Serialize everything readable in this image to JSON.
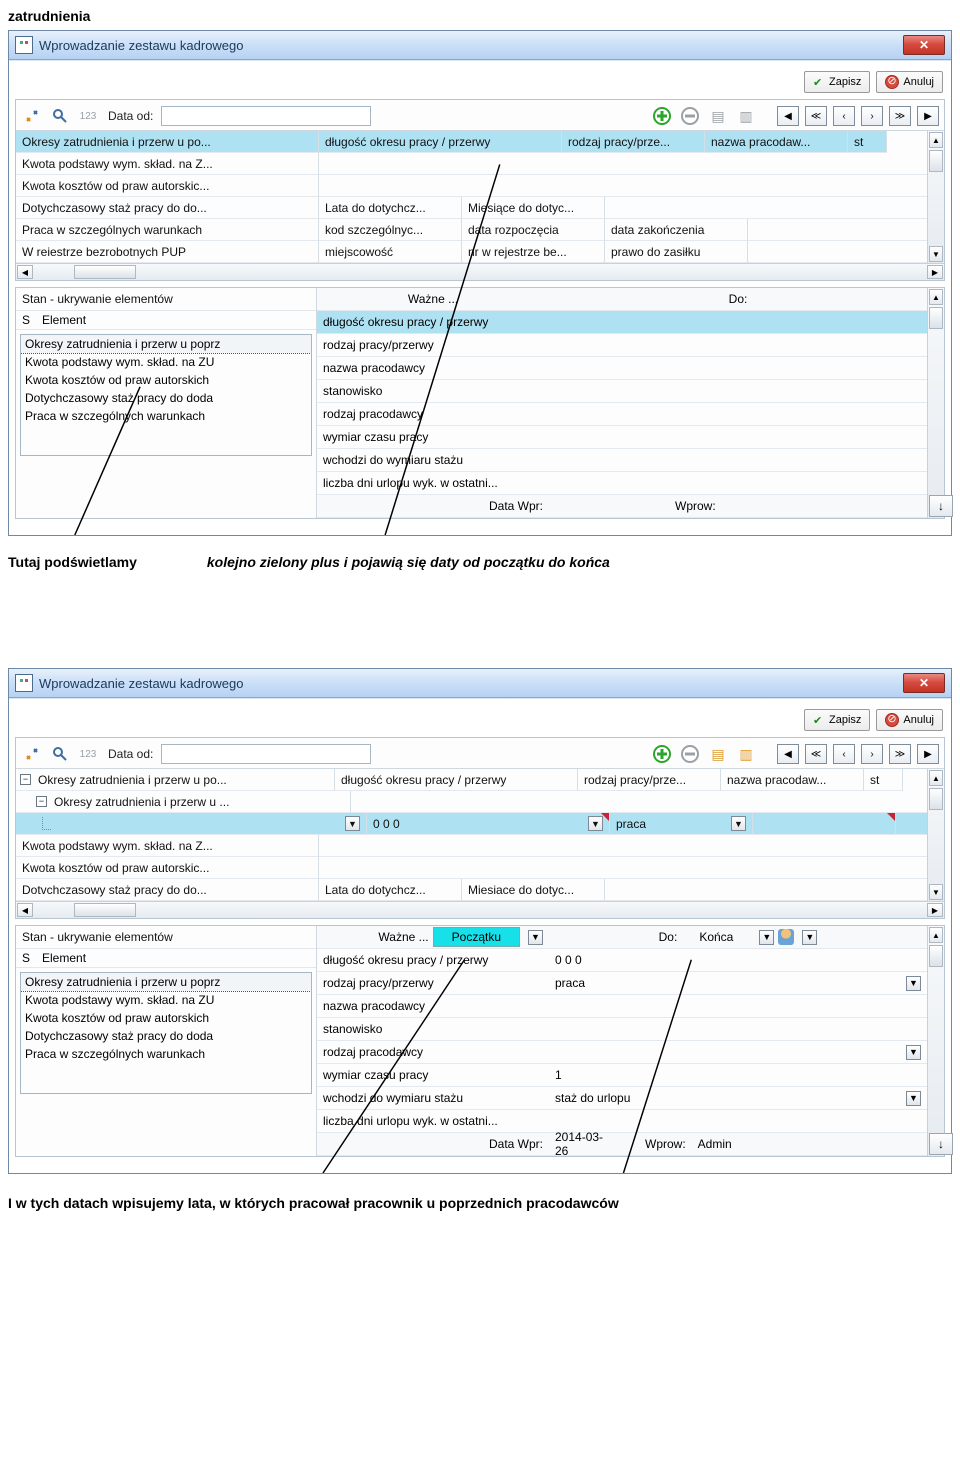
{
  "doc_title": "zatrudnienia",
  "caption1_left": "Tutaj podświetlamy",
  "caption1_right": "kolejno zielony plus i pojawią się daty od początku do końca",
  "caption2": "I w tych datach wpisujemy lata, w których pracował pracownik u poprzednich pracodawców",
  "window_title": "Wprowadzanie zestawu kadrowego",
  "save_label": "Zapisz",
  "cancel_label": "Anuluj",
  "data_od_label": "Data od:",
  "grid1_cols": {
    "c1": "długość okresu pracy / przerwy",
    "c2": "rodzaj pracy/prze...",
    "c3": "nazwa pracodaw...",
    "c4": "st"
  },
  "grid1_rows": [
    {
      "c0": "Okresy zatrudnienia i przerw u po...",
      "sel": true
    },
    {
      "c0": "Kwota podstawy wym. skład. na Z..."
    },
    {
      "c0": "Kwota kosztów od praw autorskic..."
    },
    {
      "c0": "Dotychczasowy staż pracy do do...",
      "c1": "Lata do dotychcz...",
      "c2": "Miesiące do dotyc..."
    },
    {
      "c0": "Praca w szczególnych warunkach",
      "c1": "kod szczególnyc...",
      "c2": "data rozpoczęcia",
      "c3": "data zakończenia"
    },
    {
      "c0": "W reiestrze bezrobotnych PUP",
      "c1": "miejscowość",
      "c2": "nr w rejestrze be...",
      "c3": "prawo do zasiłku"
    }
  ],
  "stan_title": "Stan - ukrywanie elementów",
  "stan_s": "S",
  "stan_element": "Element",
  "stan_list": [
    "Okresy zatrudnienia i przerw u poprz",
    "Kwota podstawy wym. skład. na ZU",
    "Kwota kosztów od praw autorskich",
    "Dotychczasowy staż pracy do doda",
    "Praca w szczególnych warunkach"
  ],
  "wazne_label": "Ważne ...",
  "do_label": "Do:",
  "props1": [
    {
      "k": "długość okresu pracy / przerwy",
      "sel": true
    },
    {
      "k": "rodzaj pracy/przerwy"
    },
    {
      "k": "nazwa pracodawcy"
    },
    {
      "k": "stanowisko"
    },
    {
      "k": "rodzaj pracodawcy"
    },
    {
      "k": "wymiar czasu pracy"
    },
    {
      "k": "wchodzi do wymiaru stażu"
    },
    {
      "k": "liczba dni urlopu wyk. w ostatni..."
    }
  ],
  "datawpr_label": "Data Wpr:",
  "wprow_label": "Wprow:",
  "grid2_rows": [
    {
      "c0": "Okresy zatrudnienia i przerw u po...",
      "tree": "minus",
      "c1": "długość okresu pracy / przerwy",
      "c2": "rodzaj pracy/prze...",
      "c3": "nazwa pracodaw...",
      "c4": "st"
    },
    {
      "c0": "Okresy zatrudnienia i przerw u ...",
      "tree": "minus",
      "indent": 1
    },
    {
      "c0": "",
      "tree": "dotted",
      "indent": 2,
      "sel": true,
      "c1": "0  0  0",
      "c2": "praca"
    },
    {
      "c0": "Kwota podstawy wym. skład. na Z..."
    },
    {
      "c0": "Kwota kosztów od praw autorskic..."
    },
    {
      "c0": "Dotvchczasowy staż pracy do do...",
      "c1": "Lata do dotychcz...",
      "c2": "Miesiace do dotyc..."
    }
  ],
  "wazne_value2": "Początku",
  "do_value2": "Końca",
  "props2": [
    {
      "k": "długość okresu pracy / przerwy",
      "v": "0  0  0"
    },
    {
      "k": "rodzaj pracy/przerwy",
      "v": "praca",
      "dd": true
    },
    {
      "k": "nazwa pracodawcy"
    },
    {
      "k": "stanowisko"
    },
    {
      "k": "rodzaj pracodawcy",
      "dd": true
    },
    {
      "k": "wymiar czasu pracy",
      "v": "1"
    },
    {
      "k": "wchodzi do wymiaru stażu",
      "v": "staż do urlopu",
      "dd": true
    },
    {
      "k": "liczba dni urlopu wyk. w ostatni..."
    }
  ],
  "datawpr_value2": "2014-03-26",
  "wprow_value2": "Admin"
}
